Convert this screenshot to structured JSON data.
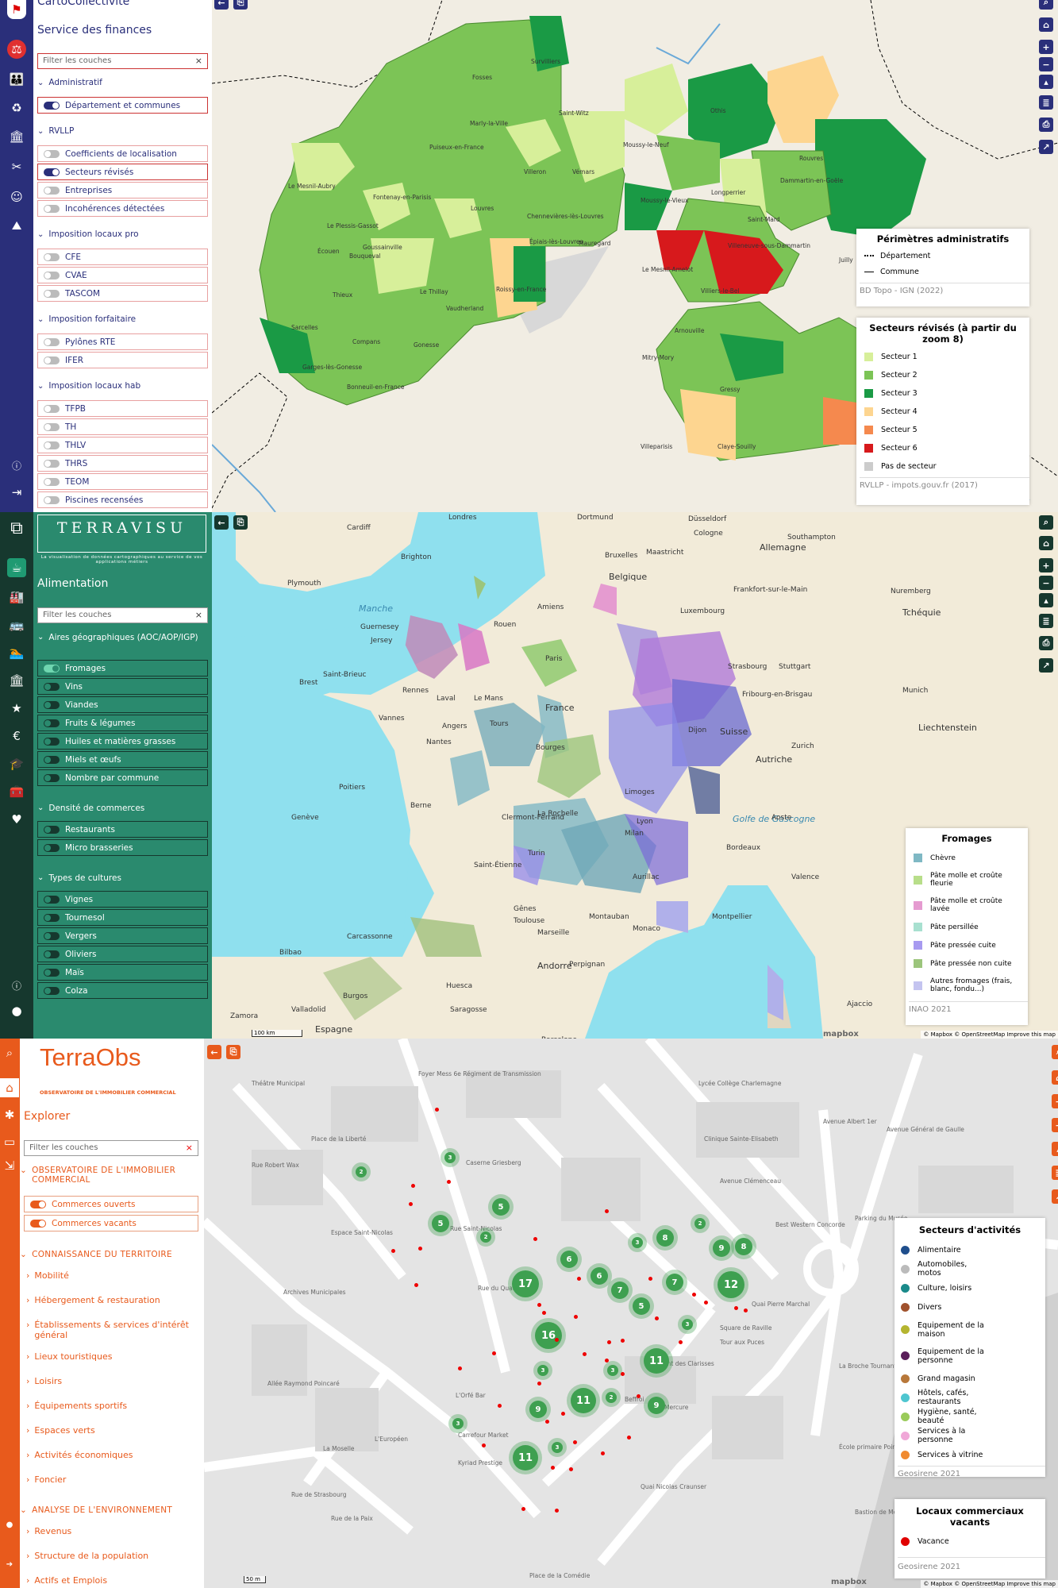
{
  "p1": {
    "app_title": "CartoCollectivité",
    "section_title": "Service des finances",
    "filter_placeholder": "Filter les couches",
    "groups": [
      {
        "label": "Administratif",
        "layers": [
          {
            "label": "Département et communes",
            "on": true
          }
        ]
      },
      {
        "label": "RVLLP",
        "layers": [
          {
            "label": "Coefficients de localisation",
            "on": false
          },
          {
            "label": "Secteurs révisés",
            "on": true
          },
          {
            "label": "Entreprises",
            "on": false
          },
          {
            "label": "Incohérences détectées",
            "on": false
          }
        ]
      },
      {
        "label": "Imposition locaux pro",
        "layers": [
          {
            "label": "CFE",
            "on": false
          },
          {
            "label": "CVAE",
            "on": false
          },
          {
            "label": "TASCOM",
            "on": false
          }
        ]
      },
      {
        "label": "Imposition forfaitaire",
        "layers": [
          {
            "label": "Pylônes RTE",
            "on": false
          },
          {
            "label": "IFER",
            "on": false
          }
        ]
      },
      {
        "label": "Imposition locaux hab",
        "layers": [
          {
            "label": "TFPB",
            "on": false
          },
          {
            "label": "TH",
            "on": false
          },
          {
            "label": "THLV",
            "on": false
          },
          {
            "label": "THRS",
            "on": false
          },
          {
            "label": "TEOM",
            "on": false
          },
          {
            "label": "Piscines recensées",
            "on": false
          }
        ]
      }
    ],
    "legend_admin": {
      "title": "Périmètres administratifs",
      "items": [
        "Département",
        "Commune"
      ],
      "source": "BD Topo - IGN (2022)"
    },
    "legend_sect": {
      "title": "Secteurs révisés (à partir du zoom 8)",
      "items": [
        {
          "label": "Secteur 1",
          "color": "#d7ef9a"
        },
        {
          "label": "Secteur 2",
          "color": "#7cc456"
        },
        {
          "label": "Secteur 3",
          "color": "#1a9a45"
        },
        {
          "label": "Secteur 4",
          "color": "#fdd590"
        },
        {
          "label": "Secteur 5",
          "color": "#f5894e"
        },
        {
          "label": "Secteur 6",
          "color": "#d7191c"
        },
        {
          "label": "Pas de secteur",
          "color": "#cccccc"
        }
      ],
      "source": "RVLLP - impots.gouv.fr (2017)"
    },
    "towns": [
      "Fosses",
      "Survilliers",
      "Marly-la-Ville",
      "Saint-Witz",
      "Othis",
      "Puiseux-en-France",
      "Moussy-le-Neuf",
      "Villeron",
      "Vémars",
      "Rouvres",
      "Le Mesnil-Aubry",
      "Dammartin-en-Goële",
      "Fontenay-en-Parisis",
      "Longperrier",
      "Moussy-le-Vieux",
      "Louvres",
      "Chennevières-lès-Louvres",
      "Le Plessis-Gassot",
      "Saint-Mard",
      "Épiais-lès-Louvres",
      "Mauregard",
      "Écouen",
      "Goussainville",
      "Villeneuve-sous-Dammartin",
      "Bouqueval",
      "Juilly",
      "Le Mesnil-Amelot",
      "Roissy-en-France",
      "Le Thillay",
      "Villiers-le-Bel",
      "Thieux",
      "Vaudherland",
      "Sarcelles",
      "Arnouville",
      "Compans",
      "Gonesse",
      "Garges-lès-Gonesse",
      "Mitry-Mory",
      "Bonneuil-en-France",
      "Gressy",
      "Villeparisis",
      "Claye-Souilly"
    ]
  },
  "p2": {
    "brand": "TERRAVISU",
    "brand_tagline": "La visualisation de données cartographiques au service de vos applications métiers",
    "section_title": "Alimentation",
    "filter_placeholder": "Filter les couches",
    "groups": [
      {
        "label": "Aires géographiques (AOC/AOP/IGP)",
        "layers": [
          {
            "label": "Fromages",
            "on": true
          },
          {
            "label": "Vins",
            "on": false
          },
          {
            "label": "Viandes",
            "on": false
          },
          {
            "label": "Fruits & légumes",
            "on": false
          },
          {
            "label": "Huiles et matières grasses",
            "on": false
          },
          {
            "label": "Miels et œufs",
            "on": false
          },
          {
            "label": "Nombre par commune",
            "on": false
          }
        ]
      },
      {
        "label": "Densité de commerces",
        "layers": [
          {
            "label": "Restaurants",
            "on": false
          },
          {
            "label": "Micro brasseries",
            "on": false
          }
        ]
      },
      {
        "label": "Types de cultures",
        "layers": [
          {
            "label": "Vignes",
            "on": false
          },
          {
            "label": "Tournesol",
            "on": false
          },
          {
            "label": "Vergers",
            "on": false
          },
          {
            "label": "Oliviers",
            "on": false
          },
          {
            "label": "Maïs",
            "on": false
          },
          {
            "label": "Colza",
            "on": false
          }
        ]
      }
    ],
    "legend": {
      "title": "Fromages",
      "items": [
        {
          "label": "Chèvre",
          "color": "#7fb8c4"
        },
        {
          "label": "Pâte molle et croûte fleurie",
          "color": "#b8de8a"
        },
        {
          "label": "Pâte molle et croûte lavée",
          "color": "#e59bd0"
        },
        {
          "label": "Pâte persillée",
          "color": "#a8e0d0"
        },
        {
          "label": "Pâte pressée cuite",
          "color": "#a79af0"
        },
        {
          "label": "Pâte pressée non cuite",
          "color": "#9cc57c"
        },
        {
          "label": "Autres fromages (frais, blanc, fondu...)",
          "color": "#c4c4f0"
        }
      ],
      "source": "INAO 2021"
    },
    "places": [
      "Londres",
      "Cardiff",
      "Dortmund",
      "Düsseldorf",
      "Cologne",
      "Allemagne",
      "Southampton",
      "Brighton",
      "Bruxelles",
      "Maastricht",
      "Belgique",
      "Plymouth",
      "Frankfort-sur-le-Main",
      "Manche",
      "Amiens",
      "Luxembourg",
      "Guernesey",
      "Jersey",
      "Rouen",
      "Nuremberg",
      "Tchéquie",
      "Paris",
      "Stuttgart",
      "Brest",
      "Saint-Brieuc",
      "Rennes",
      "Laval",
      "Le Mans",
      "France",
      "Strasbourg",
      "Munich",
      "Vannes",
      "Angers",
      "Tours",
      "Fribourg-en-Brisgau",
      "Nantes",
      "Bourges",
      "Dijon",
      "Zurich",
      "Liechtenstein",
      "Autriche",
      "Suisse",
      "Poitiers",
      "Berne",
      "La Rochelle",
      "Limoges",
      "Clermont-Ferrand",
      "Genève",
      "Lyon",
      "Golfe de Gascogne",
      "Aoste",
      "Milan",
      "Saint-Étienne",
      "Bordeaux",
      "Turin",
      "Aurillac",
      "Valence",
      "Gênes",
      "Toulouse",
      "Montauban",
      "Montpellier",
      "Monaco",
      "Marseille",
      "Carcassonne",
      "Bilbao",
      "Andorre",
      "Perpignan",
      "Ajaccio",
      "Huesca",
      "Burgos",
      "Saragosse",
      "Valladolid",
      "Espagne",
      "Barcelone",
      "Zamora"
    ],
    "scale": "100 km",
    "attrib": "© Mapbox © OpenStreetMap  Improve this map",
    "mapbox": "mapbox"
  },
  "p3": {
    "brand": "TerraObs",
    "brand_tagline": "OBSERVATOIRE DE L'IMMOBILIER COMMERCIAL",
    "section_title": "Explorer",
    "filter_placeholder": "Filter les couches",
    "sections": [
      {
        "label": "OBSERVATOIRE DE L'IMMOBILIER COMMERCIAL",
        "layers": [
          {
            "label": "Commerces ouverts",
            "on": true
          },
          {
            "label": "Commerces vacants",
            "on": true
          }
        ]
      },
      {
        "label": "CONNAISSANCE DU TERRITOIRE",
        "items": [
          "Mobilité",
          "Hébergement & restauration",
          "Établissements & services d'intérêt général",
          "Lieux touristiques",
          "Loisirs",
          "Équipements sportifs",
          "Espaces verts",
          "Activités économiques",
          "Foncier"
        ]
      },
      {
        "label": "ANALYSE DE L'ENVIRONNEMENT",
        "items": [
          "Revenus",
          "Structure de la population",
          "Actifs et Emplois"
        ]
      }
    ],
    "legend_act": {
      "title": "Secteurs d'activités",
      "items": [
        {
          "label": "Alimentaire",
          "color": "#1f4e8c"
        },
        {
          "label": "Automobiles, motos",
          "color": "#bbbbbb"
        },
        {
          "label": "Culture, loisirs",
          "color": "#1a8a8a"
        },
        {
          "label": "Divers",
          "color": "#a0522d"
        },
        {
          "label": "Equipement de la maison",
          "color": "#b5b530"
        },
        {
          "label": "Equipement de la personne",
          "color": "#5a1e5a"
        },
        {
          "label": "Grand magasin",
          "color": "#b8783a"
        },
        {
          "label": "Hôtels, cafés, restaurants",
          "color": "#4fc6d0"
        },
        {
          "label": "Hygiène, santé, beauté",
          "color": "#9acb5a"
        },
        {
          "label": "Services à la personne",
          "color": "#f0a8d8"
        },
        {
          "label": "Services à vitrine",
          "color": "#f08a30"
        }
      ],
      "source": "Geosirene 2021"
    },
    "legend_vac": {
      "title": "Locaux commerciaux vacants",
      "items": [
        {
          "label": "Vacance",
          "color": "#e00000"
        }
      ],
      "source": "Geosirene 2021"
    },
    "streets": [
      "Théâtre Municipal",
      "Foyer Mess 6e Régiment de Transmission",
      "Lycée Collège Charlemagne",
      "Place de la Liberté",
      "Clinique Sainte-Elisabeth",
      "Caserne Griesberg",
      "Avenue Clémenceau",
      "Rue Robert Wax",
      "Espace Saint-Nicolas",
      "Rue Saint-Nicolas",
      "Archives Municipales",
      "Allée Raymond Poincaré",
      "Avenue Albert 1er",
      "Avenue Général de Gaulle",
      "Parking du Musée",
      "Best Western Concorde",
      "Square de Raville",
      "Tour aux Puces",
      "Couvent des Clarisses",
      "Rue du Quartier",
      "Beffroi",
      "Mercure",
      "L'Orfé Bar",
      "Carrefour Market",
      "Kyriad Prestige",
      "Quai Nicolas Craunser",
      "Quai Pierre Marchal",
      "Rue de Strasbourg",
      "Rue de la Paix",
      "La Broche Tournante",
      "École primaire Poincaré",
      "La Moselle",
      "L'Européen",
      "Bastion de Metz",
      "Place de la Comédie"
    ],
    "clusters": [
      "3",
      "2",
      "5",
      "5",
      "2",
      "3",
      "2",
      "8",
      "9",
      "8",
      "17",
      "6",
      "6",
      "7",
      "7",
      "12",
      "5",
      "3",
      "16",
      "3",
      "3",
      "11",
      "11",
      "9",
      "9",
      "11",
      "3",
      "3",
      "2"
    ],
    "scale": "50 m",
    "attrib": "© Mapbox © OpenStreetMap  Improve this map",
    "mapbox": "mapbox"
  }
}
